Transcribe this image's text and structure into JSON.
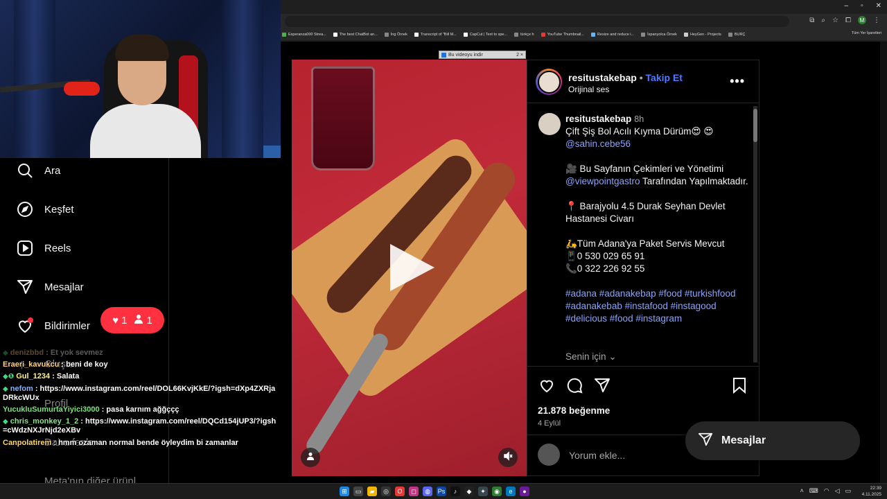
{
  "browser": {
    "window_controls": [
      "–",
      "▫",
      "✕"
    ],
    "bookmarks": [
      {
        "label": "Esperanza000 Strea..."
      },
      {
        "label": "The best ChatBot an..."
      },
      {
        "label": "İng Örnek"
      },
      {
        "label": "Transcript of \"Bill M..."
      },
      {
        "label": "CapCut | Text to spe..."
      },
      {
        "label": "türkçe h"
      },
      {
        "label": "YouTube Thumbnail..."
      },
      {
        "label": "Resize and reduce i..."
      },
      {
        "label": "İspanyolca Örnek"
      },
      {
        "label": "HeyGen - Projects"
      },
      {
        "label": "BURÇ"
      }
    ],
    "bookmarks_right": "Tüm Yer İşaretleri",
    "profile_letter": "M"
  },
  "sidebar": {
    "items": [
      {
        "label": "Ara",
        "icon": "search-icon"
      },
      {
        "label": "Keşfet",
        "icon": "compass-icon"
      },
      {
        "label": "Reels",
        "icon": "reels-icon"
      },
      {
        "label": "Mesajlar",
        "icon": "paper-plane-icon"
      },
      {
        "label": "Bildirimler",
        "icon": "heart-icon"
      }
    ],
    "ghost_labels": [
      "Oluştur",
      "Profil",
      "Daha fazla",
      "Meta'nın diğer ürünl"
    ],
    "notification_pill": {
      "likes": "1",
      "follows": "1"
    }
  },
  "chat": [
    {
      "user": "denizbbd",
      "text": " : Et yok sevmez",
      "faded": true
    },
    {
      "user": "Eraeri_kavukcu",
      "text": " : beni de koy"
    },
    {
      "user": "Gul_1234",
      "text": " : Salata",
      "badge": "◆❶"
    },
    {
      "user": "nefom",
      "text": " : https://www.instagram.com/reel/DOL66KvjKkE/?igsh=dXp4ZXRjaDRkcWUx",
      "badge": "◆"
    },
    {
      "user": "YucukluSumurtaYiyici3000",
      "text": " : pasa karnım ağğççç"
    },
    {
      "user": "chris_monkey_1_2",
      "text": " : https://www.instagram.com/reel/DQCd154jUP3/?igsh=cWdzNXJrNjd2eXBv",
      "badge": "◆"
    },
    {
      "user": "Canpolatirem",
      "text": " : hmm ozaman normal bende öyleydim bi zamanlar"
    }
  ],
  "download_banner": {
    "label": "Bu videoyu indir",
    "controls": "2 ×"
  },
  "post": {
    "username": "resitustakebap",
    "follow_label": "Takip Et",
    "dot": "•",
    "audio": "Orijinal ses",
    "more": "•••",
    "caption": {
      "username": "resitustakebap",
      "time": "8h",
      "title": "Çift Şiş Bol Acılı Kıyma Dürüm😍 😍",
      "mention1": "@sahin.cebe56",
      "line_production": "🎥 Bu Sayfanın Çekimleri ve Yönetimi",
      "mention2": "@viewpointgastro",
      "production_tail": " Tarafından Yapılmaktadır.",
      "address": "📍 Barajyolu 4.5 Durak Seyhan Devlet Hastanesi Civarı",
      "delivery": "🛵Tüm Adana'ya Paket Servis Mevcut",
      "phone1": "📱0 530 029 65 91",
      "phone2": "📞0 322 226 92 55",
      "hashtags": "#adana #adanakebap #food #turkishfood #adanakebab #instafood #instagood #delicious #food #instagram"
    },
    "senin_icin": "Senin için",
    "likes": "21.878 beğenme",
    "date": "4 Eylül",
    "comment_placeholder": "Yorum ekle..."
  },
  "messages_pill": "Mesajlar",
  "taskbar": {
    "time": "22:39",
    "date": "4.11.2025"
  }
}
